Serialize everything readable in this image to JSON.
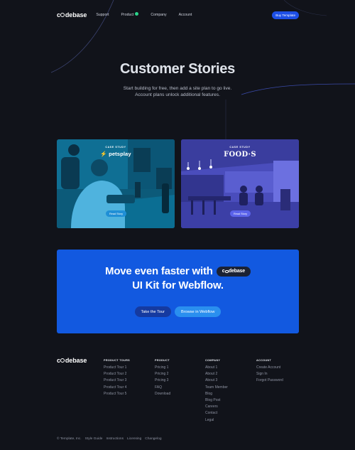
{
  "nav": {
    "brand": {
      "pre": "c",
      "post": "debase"
    },
    "links": [
      {
        "label": "Support",
        "badge": false
      },
      {
        "label": "Product",
        "badge": true
      },
      {
        "label": "Company",
        "badge": false
      },
      {
        "label": "Account",
        "badge": false
      }
    ],
    "cta": "Buy Template"
  },
  "hero": {
    "title": "Customer Stories",
    "subtitle_line1": "Start building for free, then add a site plan to go live.",
    "subtitle_line2": "Account plans unlock additional features."
  },
  "cases": [
    {
      "label": "CASE STUDY",
      "brand": "petsplay",
      "button": "Read Story",
      "tint": "#107da6"
    },
    {
      "label": "CASE STUDY",
      "brand": "FOOD·S",
      "button": "Read Story",
      "tint": "#4f52c2"
    }
  ],
  "cta": {
    "line1": "Move even faster with",
    "pill": {
      "pre": "c",
      "post": "debase"
    },
    "line2": "UI Kit for Webflow.",
    "button_tour": "Take the Tour",
    "button_browse": "Browse in Webflow",
    "color": "#1259e0"
  },
  "footer": {
    "brand": {
      "pre": "c",
      "post": "debase"
    },
    "columns": [
      {
        "title": "PRODUCT TOURS",
        "items": [
          "Product Tour 1",
          "Product Tour 2",
          "Product Tour 3",
          "Product Tour 4",
          "Product Tour 5"
        ]
      },
      {
        "title": "PRODUCT",
        "items": [
          "Pricing 1",
          "Pricing 2",
          "Pricing 3",
          "FAQ",
          "Download"
        ]
      },
      {
        "title": "COMPANY",
        "items": [
          "About 1",
          "About 2",
          "About 3",
          "Team Member",
          "Blog",
          "Blog Post",
          "Careers",
          "Contact",
          "Legal"
        ]
      },
      {
        "title": "ACCOUNT",
        "items": [
          "Create Account",
          "Sign In",
          "Forgot Password"
        ]
      }
    ],
    "bottom": [
      "© Template, Inc.",
      "Style Guide",
      "Instructions",
      "Licensing",
      "Changelog"
    ]
  },
  "colors": {
    "background": "#11131a",
    "accent": "#1d4fe6",
    "badge": "#2bd48b"
  }
}
